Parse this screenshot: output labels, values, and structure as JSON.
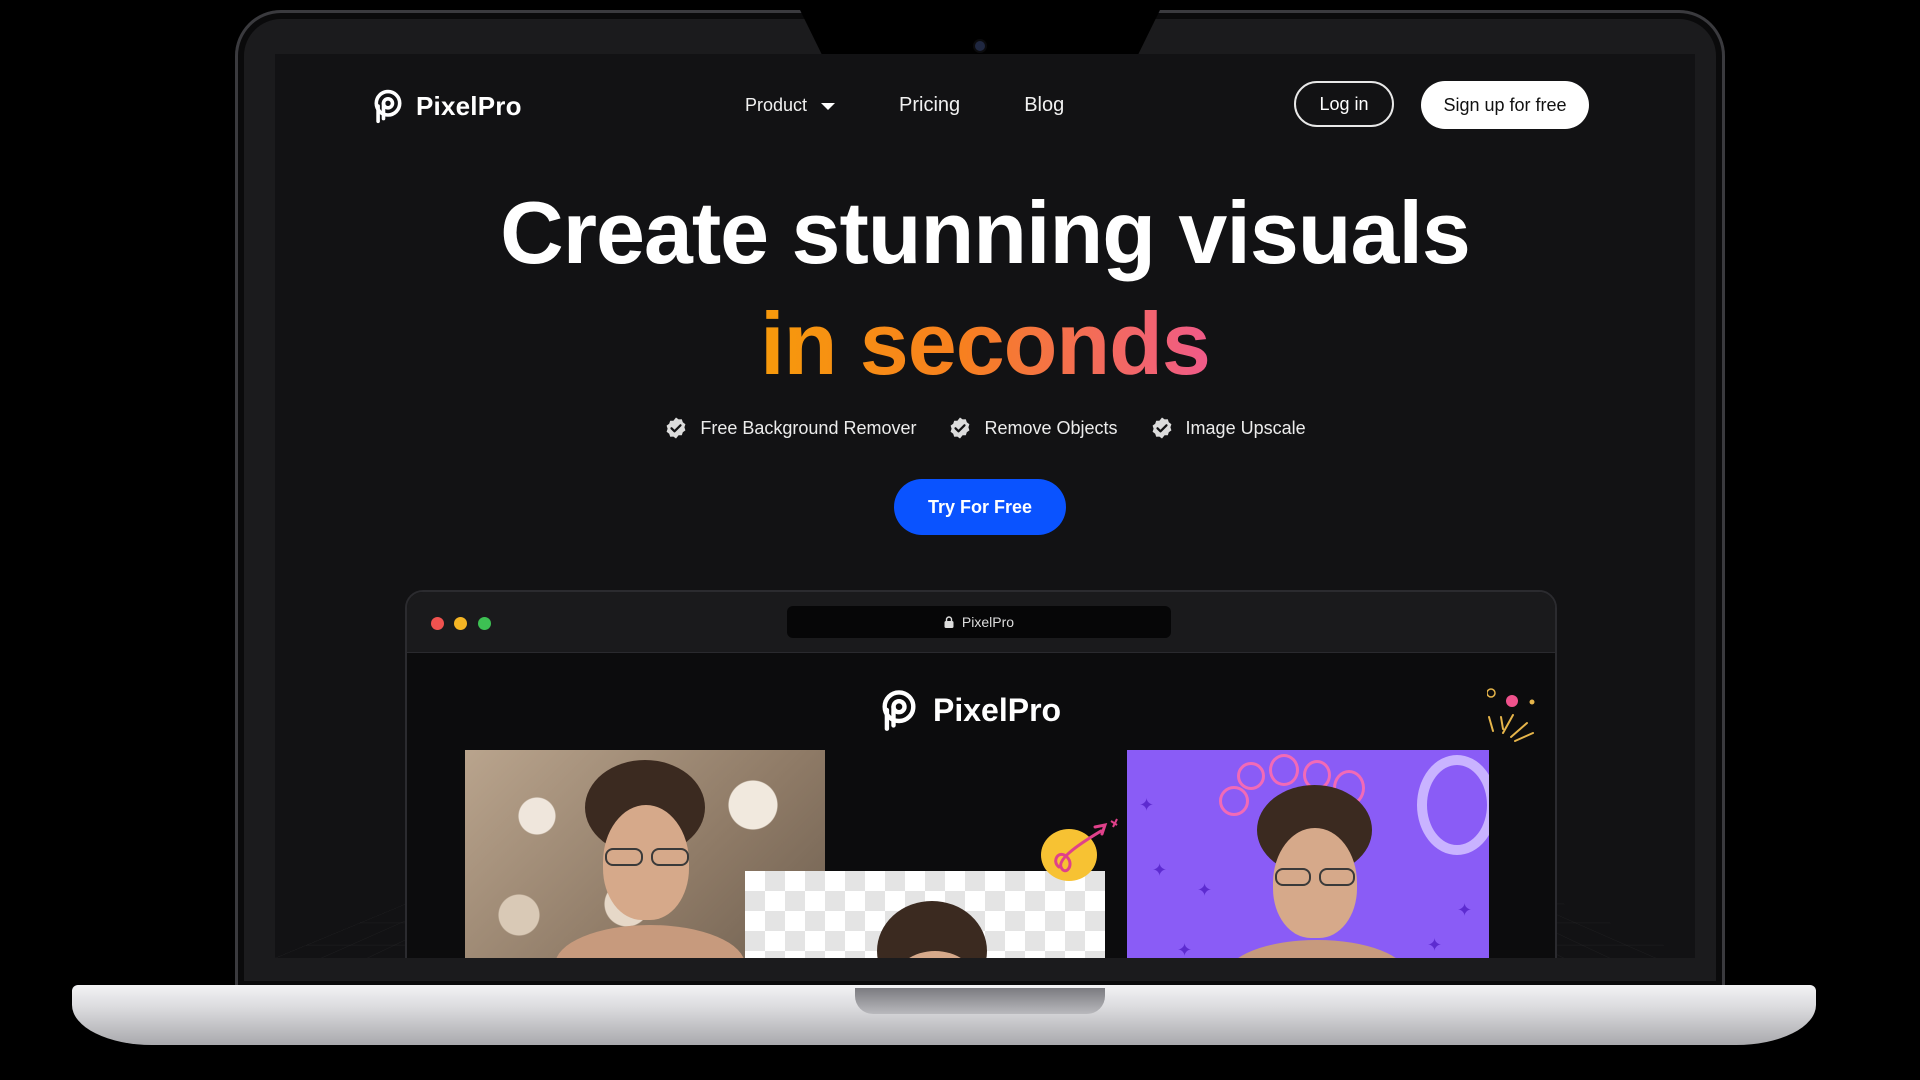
{
  "nav": {
    "brand": "PixelPro",
    "links": [
      "Product",
      "Pricing",
      "Blog"
    ],
    "login": "Log in",
    "signup": "Sign up for free"
  },
  "hero": {
    "line1": "Create stunning visuals",
    "line2": "in seconds",
    "features": [
      "Free Background Remover",
      "Remove Objects",
      "Image Upscale"
    ],
    "cta": "Try For Free"
  },
  "preview": {
    "url": "PixelPro",
    "brand": "PixelPro"
  },
  "colors": {
    "background": "#121214",
    "cta": "#0a53ff",
    "gradient_start": "#f79a0b",
    "gradient_end": "#f05a8a",
    "preview_purple": "#8a5cf6"
  },
  "icons": [
    "pixelpro-logo-icon",
    "chevron-down-icon",
    "check-badge-icon",
    "lock-icon"
  ]
}
